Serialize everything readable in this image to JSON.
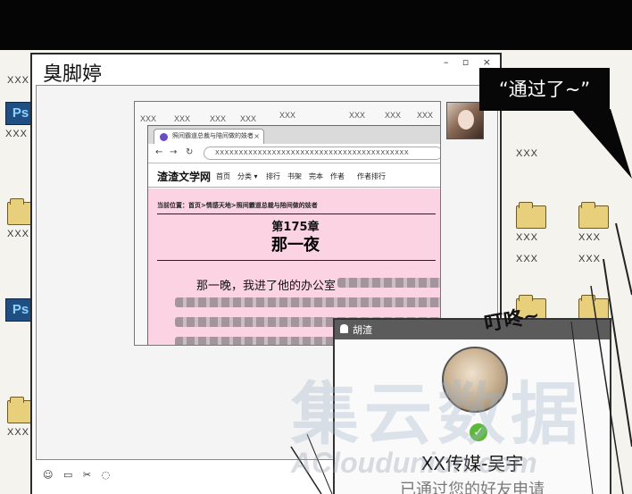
{
  "chat": {
    "title": "臭脚婷",
    "window_controls": "– ▫ ×",
    "toolbar_icons": [
      "smile-icon",
      "folder-icon",
      "scissors-icon",
      "bubble-icon"
    ]
  },
  "desktop": {
    "icon_label": "XXX",
    "ps_label": "Ps"
  },
  "browser": {
    "tab_title": "照间霸道总裁与陪间做的妓者",
    "url": "XXXXXXXXXXXXXXXXXXXXXXXXXXXXXXXXXXXXXXXXX",
    "site_logo": "渣渣文学网",
    "nav": [
      "首页",
      "分类 ▾",
      "排行",
      "书架",
      "完本",
      "作者",
      "作者排行"
    ],
    "breadcrumb": "当前位置：首页>情感天地>照间霸道总裁与陪间做的妓者",
    "chapter_number": "第175章",
    "chapter_title": "那一夜",
    "first_line": "那一晚，我进了他的办公室"
  },
  "popup": {
    "header_name": "胡渣",
    "friend_name": "XX传媒-吴宇",
    "status": "已通过您的好友申请"
  },
  "sfx": "叮咚~",
  "speech": "“通过了~”",
  "watermark": {
    "cn": "集云数据",
    "en": "ACloudunion.com"
  },
  "colors": {
    "page_pink": "#fbd3e3",
    "check_green": "#5bb83a",
    "popup_header": "#5b5b5b"
  }
}
